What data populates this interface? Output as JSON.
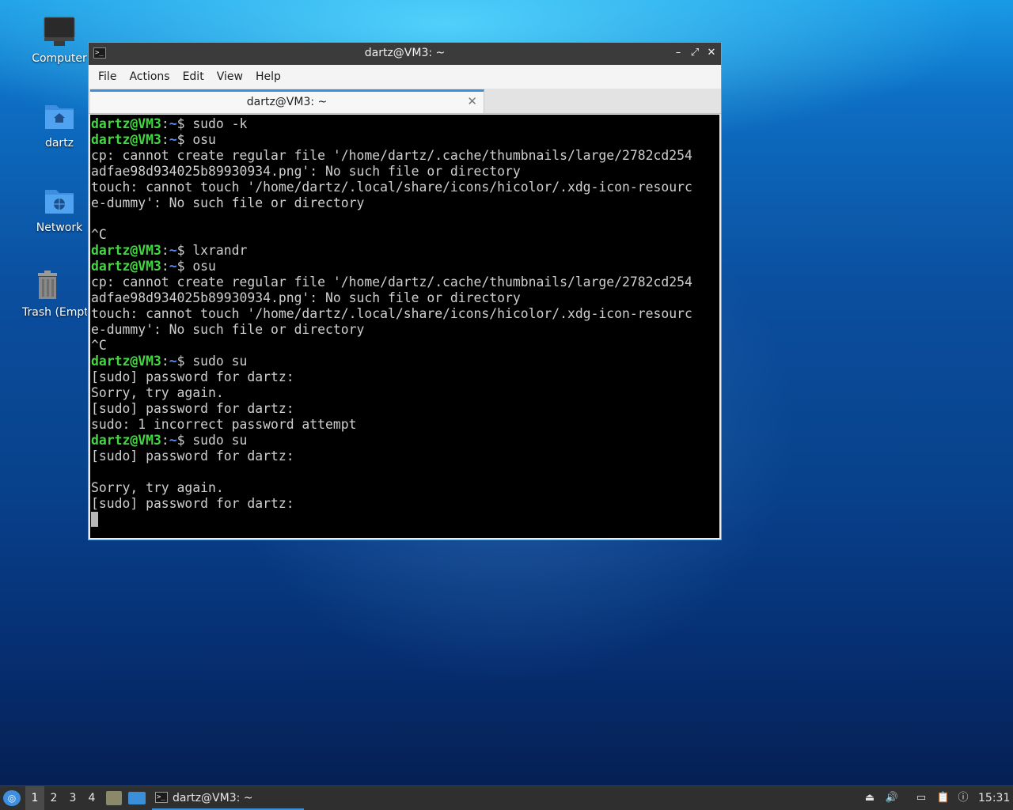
{
  "desktop": {
    "icons": [
      {
        "label": "Computer"
      },
      {
        "label": "dartz"
      },
      {
        "label": "Network"
      },
      {
        "label": "Trash (Empty)"
      }
    ]
  },
  "window": {
    "title": "dartz@VM3: ~",
    "controls": {
      "minimize": "–",
      "maximize": "⤢",
      "close": "✕"
    },
    "menu": [
      "File",
      "Actions",
      "Edit",
      "View",
      "Help"
    ],
    "tab": {
      "title": "dartz@VM3: ~",
      "close": "✕"
    }
  },
  "terminal": {
    "prompt_user": "dartz@VM3",
    "prompt_sep": ":",
    "prompt_path": "~",
    "prompt_sym": "$ ",
    "lines": [
      {
        "type": "prompt",
        "cmd": "sudo -k"
      },
      {
        "type": "prompt",
        "cmd": "osu"
      },
      {
        "type": "out",
        "text": "cp: cannot create regular file '/home/dartz/.cache/thumbnails/large/2782cd254"
      },
      {
        "type": "out",
        "text": "adfae98d934025b89930934.png': No such file or directory"
      },
      {
        "type": "out",
        "text": "touch: cannot touch '/home/dartz/.local/share/icons/hicolor/.xdg-icon-resourc"
      },
      {
        "type": "out",
        "text": "e-dummy': No such file or directory"
      },
      {
        "type": "out",
        "text": ""
      },
      {
        "type": "out",
        "text": "^C"
      },
      {
        "type": "prompt",
        "cmd": "lxrandr"
      },
      {
        "type": "prompt",
        "cmd": "osu"
      },
      {
        "type": "out",
        "text": "cp: cannot create regular file '/home/dartz/.cache/thumbnails/large/2782cd254"
      },
      {
        "type": "out",
        "text": "adfae98d934025b89930934.png': No such file or directory"
      },
      {
        "type": "out",
        "text": "touch: cannot touch '/home/dartz/.local/share/icons/hicolor/.xdg-icon-resourc"
      },
      {
        "type": "out",
        "text": "e-dummy': No such file or directory"
      },
      {
        "type": "out",
        "text": "^C"
      },
      {
        "type": "prompt",
        "cmd": "sudo su"
      },
      {
        "type": "out",
        "text": "[sudo] password for dartz:"
      },
      {
        "type": "out",
        "text": "Sorry, try again."
      },
      {
        "type": "out",
        "text": "[sudo] password for dartz:"
      },
      {
        "type": "out",
        "text": "sudo: 1 incorrect password attempt"
      },
      {
        "type": "prompt",
        "cmd": "sudo su"
      },
      {
        "type": "out",
        "text": "[sudo] password for dartz:"
      },
      {
        "type": "out",
        "text": ""
      },
      {
        "type": "out",
        "text": "Sorry, try again."
      },
      {
        "type": "out",
        "text": "[sudo] password for dartz:"
      },
      {
        "type": "cursor"
      }
    ]
  },
  "taskbar": {
    "desktops": [
      "1",
      "2",
      "3",
      "4"
    ],
    "active_desktop": "1",
    "task_title": "dartz@VM3: ~",
    "clock": "15:31"
  },
  "colors": {
    "prompt_user": "#43d743",
    "prompt_path": "#5b8cf2",
    "accent": "#3b8fd9"
  }
}
